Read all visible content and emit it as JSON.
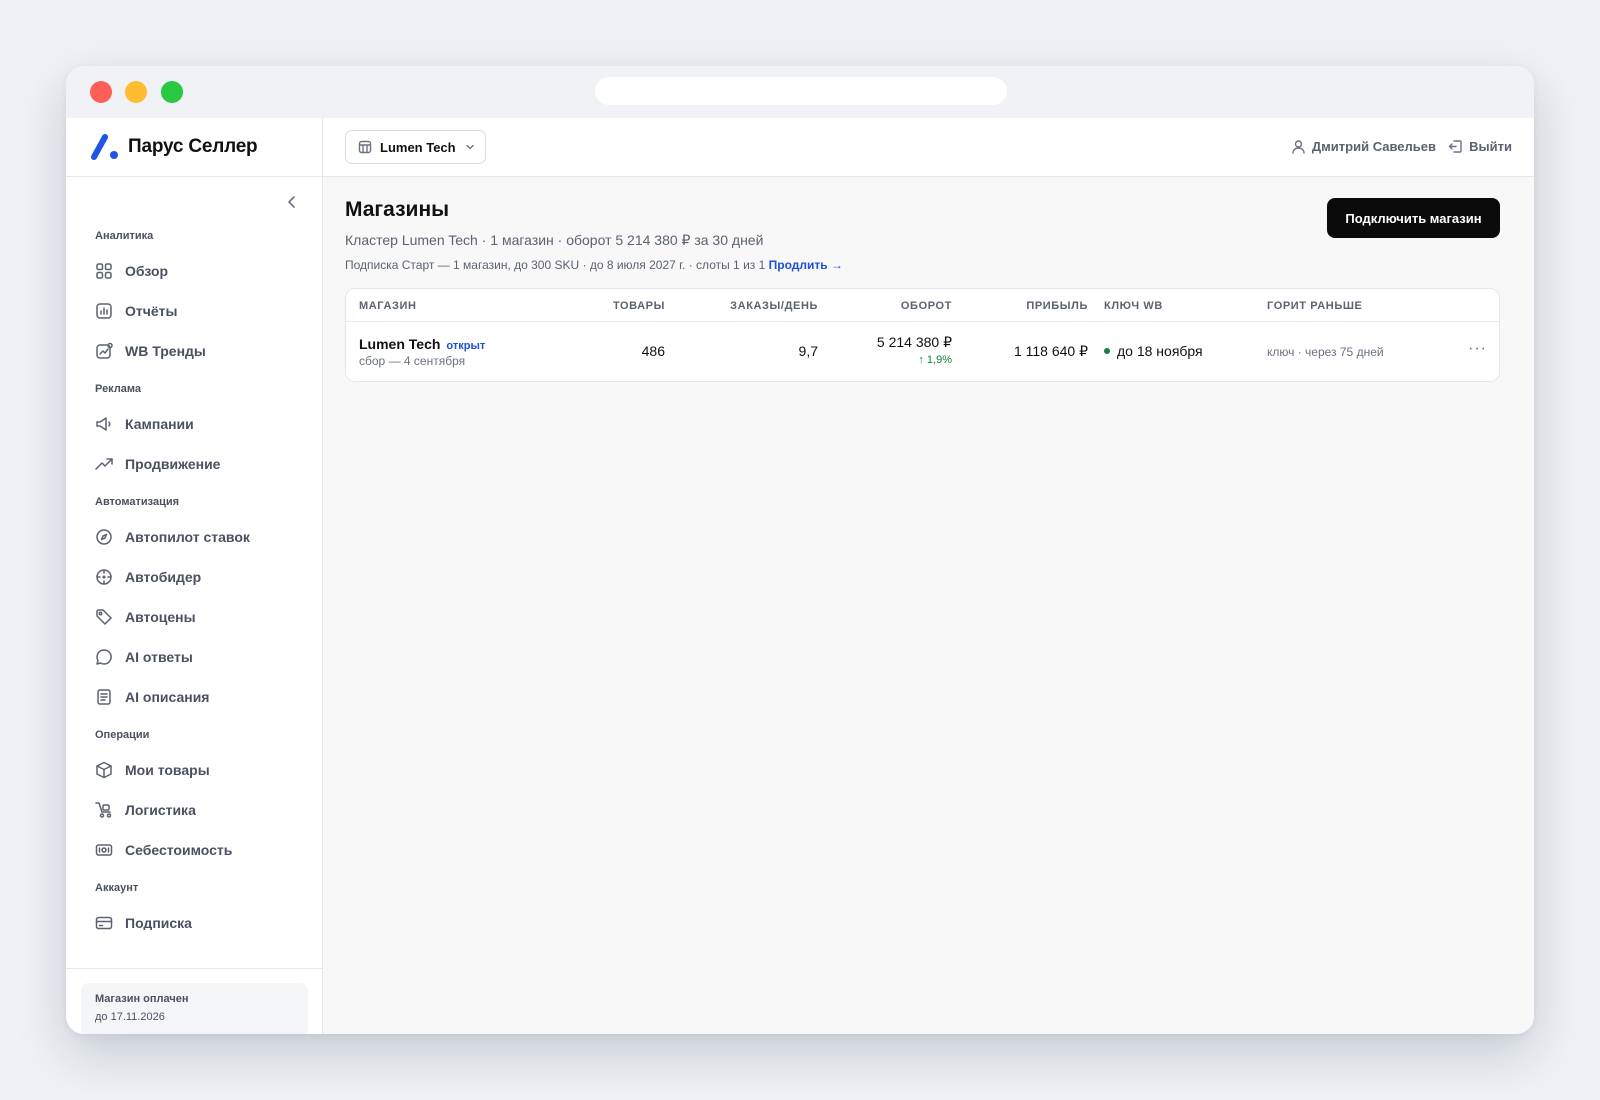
{
  "app": {
    "name": "Парус Селлер"
  },
  "sidebar": {
    "collapse_icon": "chevron-left-icon",
    "groups": [
      {
        "title": "Аналитика",
        "items": [
          {
            "label": "Обзор",
            "icon": "grid-icon"
          },
          {
            "label": "Отчёты",
            "icon": "report-icon"
          },
          {
            "label": "WB Тренды",
            "icon": "trends-icon"
          }
        ]
      },
      {
        "title": "Реклама",
        "items": [
          {
            "label": "Кампании",
            "icon": "megaphone-icon"
          },
          {
            "label": "Продвижение",
            "icon": "trending-up-icon"
          }
        ]
      },
      {
        "title": "Автоматизация",
        "items": [
          {
            "label": "Автопилот ставок",
            "icon": "compass-icon"
          },
          {
            "label": "Автобидер",
            "icon": "crosshair-icon"
          },
          {
            "label": "Автоцены",
            "icon": "tag-icon"
          },
          {
            "label": "AI ответы",
            "icon": "chat-bubble-icon"
          },
          {
            "label": "AI описания",
            "icon": "document-icon"
          }
        ]
      },
      {
        "title": "Операции",
        "items": [
          {
            "label": "Мои товары",
            "icon": "box-icon"
          },
          {
            "label": "Логистика",
            "icon": "cart-icon"
          },
          {
            "label": "Себестоимость",
            "icon": "banknote-icon"
          }
        ]
      },
      {
        "title": "Аккаунт",
        "items": [
          {
            "label": "Подписка",
            "icon": "credit-card-icon"
          }
        ]
      }
    ],
    "paid": {
      "title": "Магазин оплачен",
      "date": "до 17.11.2026"
    }
  },
  "topbar": {
    "store_select": "Lumen Tech",
    "user_name": "Дмитрий Савельев",
    "logout_label": "Выйти"
  },
  "main": {
    "title": "Магазины",
    "subtitle": "Кластер Lumen Tech · 1 магазин · оборот 5 214 380 ₽ за 30 дней",
    "subscription_text": "Подписка Старт — 1 магазин, до 300 SKU · до 8 июля 2027 г. · слоты 1 из 1",
    "subscription_link": "Продлить →",
    "connect_button": "Подключить магазин",
    "table": {
      "headers": {
        "store": "МАГАЗИН",
        "products": "ТОВАРЫ",
        "orders": "ЗАКАЗЫ/ДЕНЬ",
        "turnover": "ОБОРОТ",
        "profit": "ПРИБЫЛЬ",
        "key": "КЛЮЧ WB",
        "burns": "ГОРИТ РАНЬШЕ"
      },
      "rows": [
        {
          "store": "Lumen Tech",
          "status": "открыт",
          "collected": "сбор — 4 сентября",
          "products": "486",
          "orders": "9,7",
          "turnover": "5 214 380 ₽",
          "growth": "↑ 1,9%",
          "profit": "1 118 640 ₽",
          "key": "до 18 ноября",
          "burns": "ключ · через 75 дней",
          "actions": "···"
        }
      ]
    }
  },
  "colors": {
    "accent": "#1d4fd8",
    "positive": "#15803d",
    "primary_button": "#0b0b0c"
  }
}
